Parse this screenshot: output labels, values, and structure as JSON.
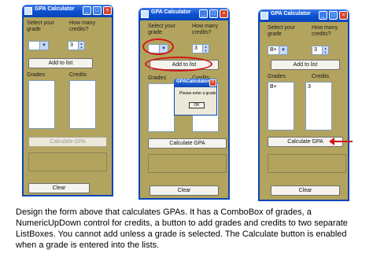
{
  "windows": [
    {
      "title": "GPA Calculator",
      "grade_label": "Select your grade",
      "credits_label": "How many credits?",
      "grade_value": "",
      "credits_value": "3",
      "add_button": "Add to list",
      "grades_header": "Grades",
      "credits_header": "Credits",
      "grades_list": [],
      "credits_list": [],
      "calculate_button": "Calculate GPA",
      "calculate_enabled": false,
      "clear_button": "Clear"
    },
    {
      "title": "GPA Calculator",
      "grade_label": "Select your grade",
      "credits_label": "How many credits?",
      "grade_value": "",
      "credits_value": "3",
      "add_button": "Add to list",
      "grades_header": "Grades",
      "credits_header": "Credits",
      "grades_list": [],
      "credits_list": [],
      "calculate_button": "Calculate GPA",
      "calculate_enabled": true,
      "clear_button": "Clear",
      "dialog": {
        "title": "GPACalculator",
        "message": "Please enter a grade.",
        "ok_button": "OK"
      }
    },
    {
      "title": "GPA Calculator",
      "grade_label": "Select your grade",
      "credits_label": "How many credits?",
      "grade_value": "B+",
      "credits_value": "3",
      "add_button": "Add to list",
      "grades_header": "Grades",
      "credits_header": "Credits",
      "grades_list": [
        "B+"
      ],
      "credits_list": [
        "3"
      ],
      "calculate_button": "Calculate GPA",
      "calculate_enabled": true,
      "clear_button": "Clear"
    }
  ],
  "description": "Design the form above that calculates GPAs.  It has a ComboBox of grades, a NumericUpDown control for credits, a button to add grades and credits to two separate ListBoxes.  You cannot add unless a grade is selected. The Calculate button is enabled when a grade is entered into the lists.",
  "colors": {
    "form_background": "#b2a45e",
    "titlebar": "#0b46b6",
    "highlight": "#d01818"
  }
}
